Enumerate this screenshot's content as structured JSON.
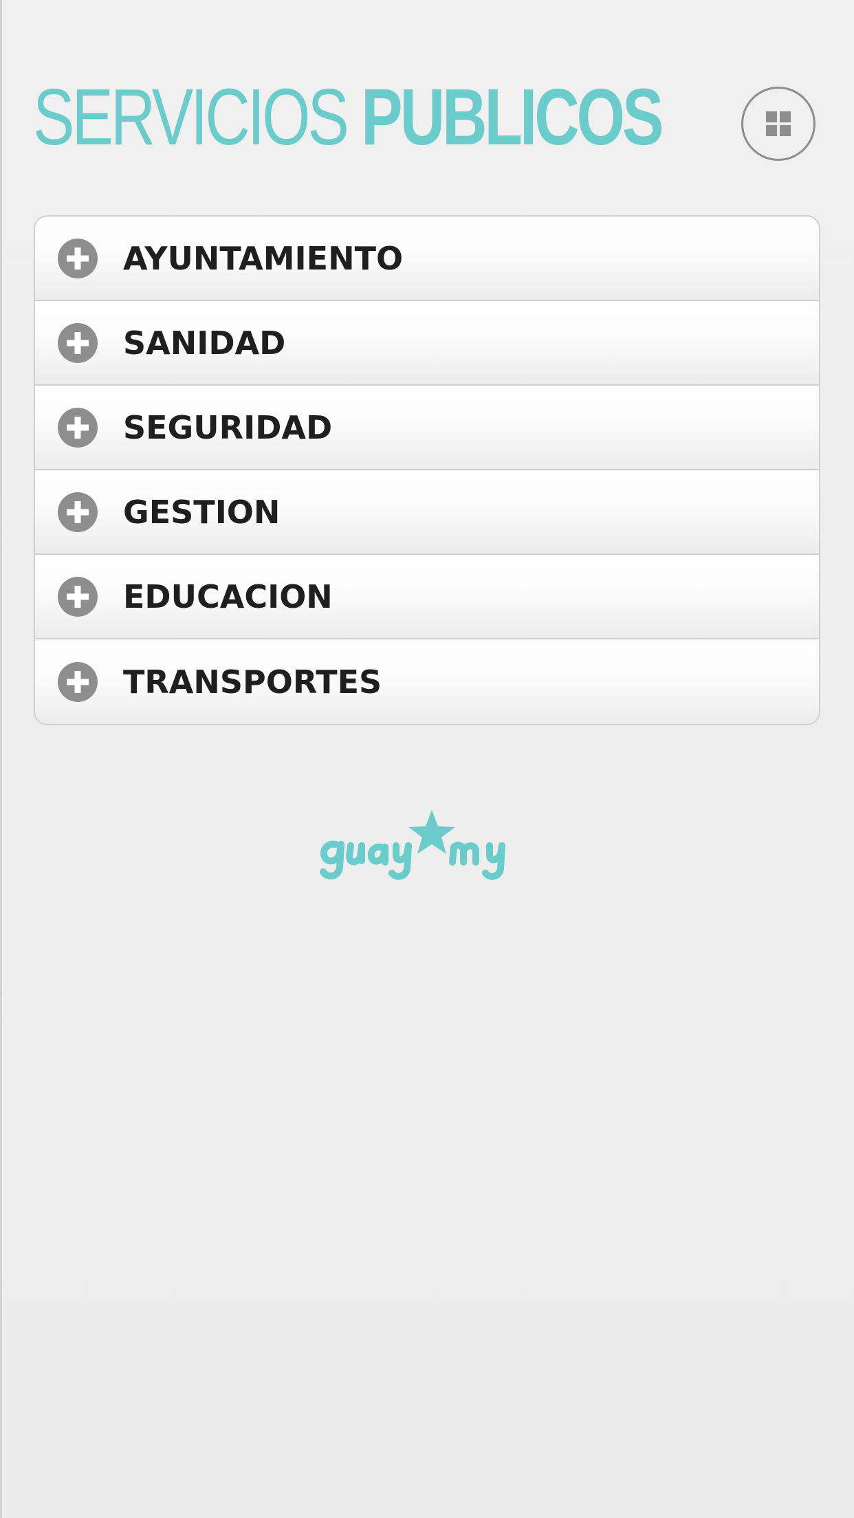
{
  "header": {
    "title_light": "SERVICIOS",
    "title_bold": "PUBLICOS",
    "menu_icon": "grid-icon"
  },
  "menu": {
    "items": [
      {
        "label": "AYUNTAMIENTO",
        "icon": "plus-circle-icon"
      },
      {
        "label": "SANIDAD",
        "icon": "plus-circle-icon"
      },
      {
        "label": "SEGURIDAD",
        "icon": "plus-circle-icon"
      },
      {
        "label": "GESTION",
        "icon": "plus-circle-icon"
      },
      {
        "label": "EDUCACION",
        "icon": "plus-circle-icon"
      },
      {
        "label": "TRANSPORTES",
        "icon": "plus-circle-icon"
      }
    ]
  },
  "footer": {
    "logo_text": "guaymy"
  },
  "colors": {
    "accent": "#6ccbcb",
    "background": "#ededed",
    "icon_gray": "#8e8e8e",
    "text": "#1f1f1f"
  }
}
